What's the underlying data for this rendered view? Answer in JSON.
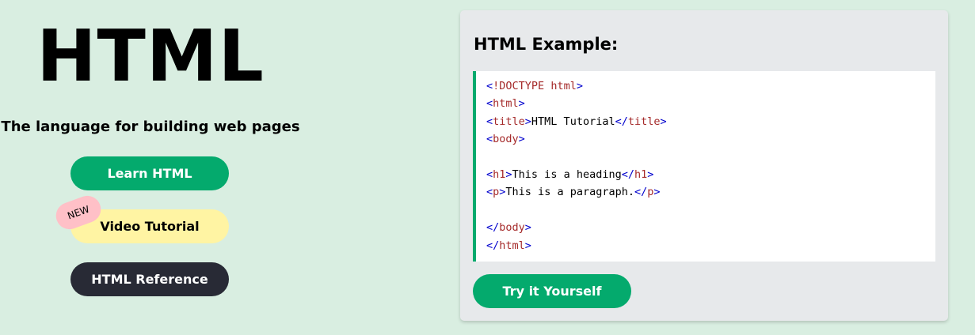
{
  "hero": {
    "title": "HTML",
    "tagline": "The language for building web pages",
    "learn_button": "Learn HTML",
    "video_button": "Video Tutorial",
    "new_badge": "NEW",
    "reference_button": "HTML Reference"
  },
  "example": {
    "heading": "HTML Example:",
    "try_button": "Try it Yourself",
    "code": {
      "l1_open": "<",
      "l1_doctype": "!DOCTYPE",
      "l1_space": " ",
      "l1_html": "html",
      "l1_close": ">",
      "l2_open": "<",
      "l2_tag": "html",
      "l2_close": ">",
      "l3_open": "<",
      "l3_tag": "title",
      "l3_close": ">",
      "l3_text": "HTML Tutorial",
      "l3_end_open": "</",
      "l3_end_tag": "title",
      "l3_end_close": ">",
      "l4_open": "<",
      "l4_tag": "body",
      "l4_close": ">",
      "l6_open": "<",
      "l6_tag": "h1",
      "l6_close": ">",
      "l6_text": "This is a heading",
      "l6_end_open": "</",
      "l6_end_tag": "h1",
      "l6_end_close": ">",
      "l7_open": "<",
      "l7_tag": "p",
      "l7_close": ">",
      "l7_text": "This is a paragraph.",
      "l7_end_open": "</",
      "l7_end_tag": "p",
      "l7_end_close": ">",
      "l9_open": "</",
      "l9_tag": "body",
      "l9_close": ">",
      "l10_open": "</",
      "l10_tag": "html",
      "l10_close": ">"
    }
  },
  "colors": {
    "page_background": "#d9eee1",
    "accent_green": "#04aa6d",
    "video_yellow": "#fff4a3",
    "reference_dark": "#282a35",
    "badge_pink": "#ffc0c7",
    "code_tag_red": "#a52a2a",
    "code_bracket_blue": "#0000cd"
  }
}
